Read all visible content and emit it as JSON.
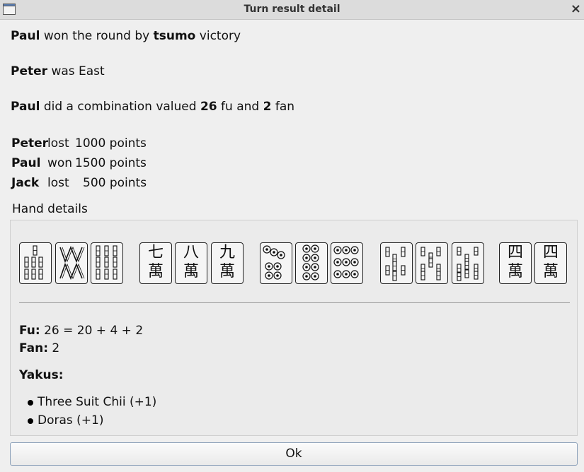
{
  "window": {
    "title": "Turn result detail",
    "close_glyph": "×"
  },
  "summary": {
    "winner": "Paul",
    "won_text": "won the round by",
    "win_type": "tsumo",
    "victory_text": "victory",
    "east_player": "Peter",
    "east_text": "was East",
    "combo_player": "Paul",
    "combo_text": "did a combination valued",
    "fu_value": "26",
    "fu_word": "fu and",
    "fan_value": "2",
    "fan_word": "fan"
  },
  "players": [
    {
      "name": "Peter",
      "result": "lost",
      "points": "1000 points"
    },
    {
      "name": "Paul",
      "result": "won",
      "points": "1500 points"
    },
    {
      "name": "Jack",
      "result": "lost",
      "points": "500 points"
    }
  ],
  "hand": {
    "label": "Hand details",
    "tiles": [
      {
        "suit": "bamboo",
        "rank": 7
      },
      {
        "suit": "bamboo",
        "rank": 8
      },
      {
        "suit": "bamboo",
        "rank": 9
      },
      {
        "suit": "characters",
        "rank": 7,
        "top": "七",
        "bottom": "萬"
      },
      {
        "suit": "characters",
        "rank": 8,
        "top": "八",
        "bottom": "萬"
      },
      {
        "suit": "characters",
        "rank": 9,
        "top": "九",
        "bottom": "萬"
      },
      {
        "suit": "circles",
        "rank": 7
      },
      {
        "suit": "circles",
        "rank": 8
      },
      {
        "suit": "circles",
        "rank": 9
      },
      {
        "suit": "bamboo",
        "rank": 7
      },
      {
        "suit": "bamboo",
        "rank": 8
      },
      {
        "suit": "bamboo",
        "rank": 9
      },
      {
        "suit": "characters",
        "rank": 4,
        "top": "四",
        "bottom": "萬"
      },
      {
        "suit": "characters",
        "rank": 4,
        "top": "四",
        "bottom": "萬"
      }
    ],
    "fu_label": "Fu:",
    "fu_formula": "26 = 20 + 4 + 2",
    "fan_label": "Fan:",
    "fan_value": "2",
    "yakus_label": "Yakus:",
    "yakus": [
      "Three Suit Chii (+1)",
      "Doras (+1)"
    ]
  },
  "ok_button": "Ok"
}
